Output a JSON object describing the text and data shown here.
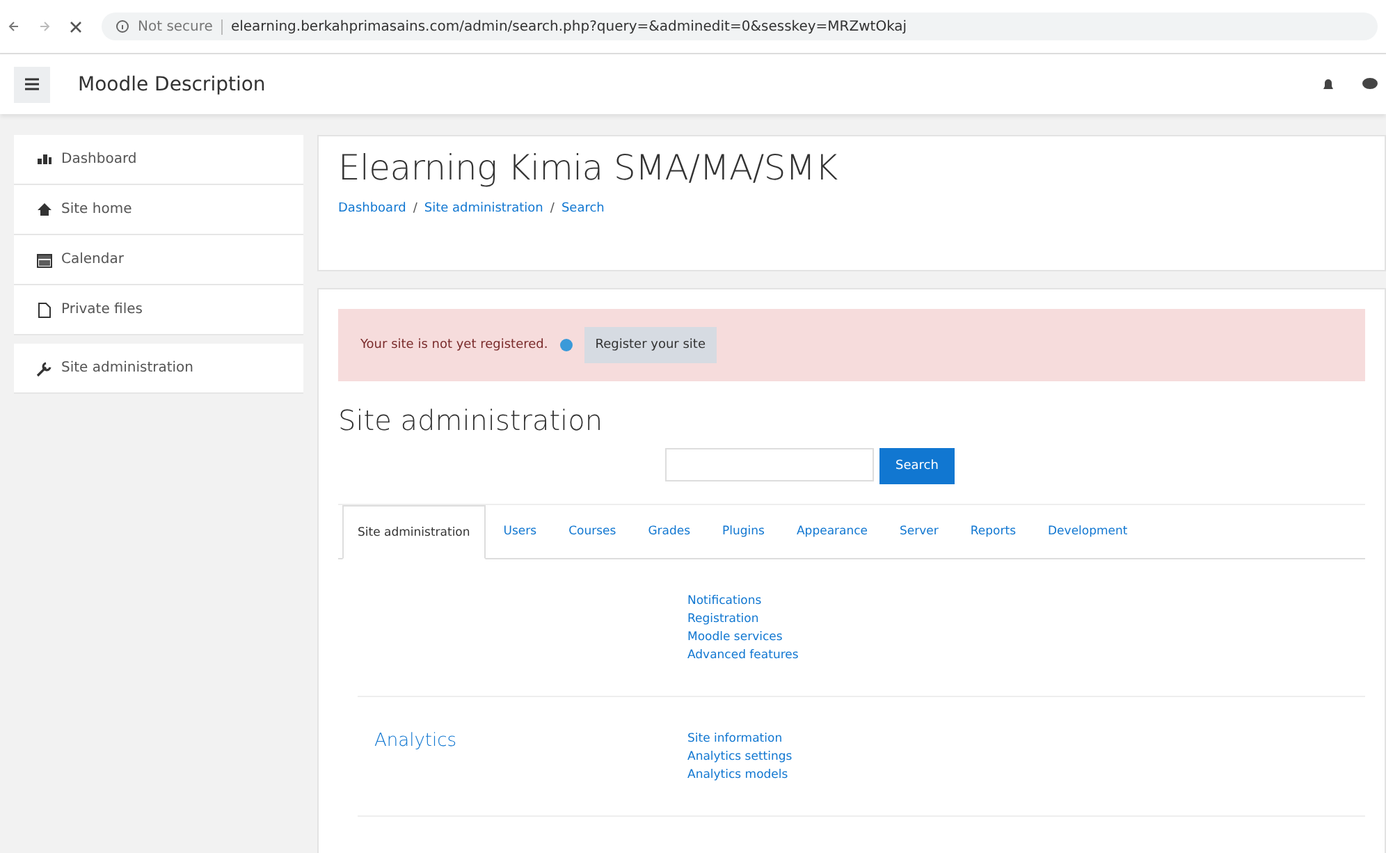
{
  "browser": {
    "security": "Not secure",
    "url": "elearning.berkahprimasains.com/admin/search.php?query=&adminedit=0&sesskey=MRZwtOkaj"
  },
  "navbar": {
    "title": "Moodle Description"
  },
  "sidebar": {
    "groups": [
      {
        "items": [
          "Dashboard",
          "Site home",
          "Calendar",
          "Private files"
        ]
      },
      {
        "items": [
          "Site administration"
        ]
      }
    ]
  },
  "header": {
    "title": "Elearning Kimia SMA/MA/SMK",
    "breadcrumb_separator": "/",
    "breadcrumb": [
      "Dashboard",
      "Site administration",
      "Search"
    ]
  },
  "alert": {
    "text": "Your site is not yet registered.",
    "button": "Register your site"
  },
  "admin": {
    "heading": "Site administration",
    "search_button": "Search",
    "tabs": [
      {
        "label": "Site administration",
        "selected": true
      },
      {
        "label": "Users",
        "selected": false
      },
      {
        "label": "Courses",
        "selected": false
      },
      {
        "label": "Grades",
        "selected": false
      },
      {
        "label": "Plugins",
        "selected": false
      },
      {
        "label": "Appearance",
        "selected": false
      },
      {
        "label": "Server",
        "selected": false
      },
      {
        "label": "Reports",
        "selected": false
      },
      {
        "label": "Development",
        "selected": false
      }
    ],
    "sections": [
      {
        "links": [
          "Notifications",
          "Registration",
          "Moodle services",
          "Advanced features"
        ]
      },
      {
        "title": "Analytics",
        "links": [
          "Site information",
          "Analytics settings",
          "Analytics models"
        ]
      }
    ]
  }
}
